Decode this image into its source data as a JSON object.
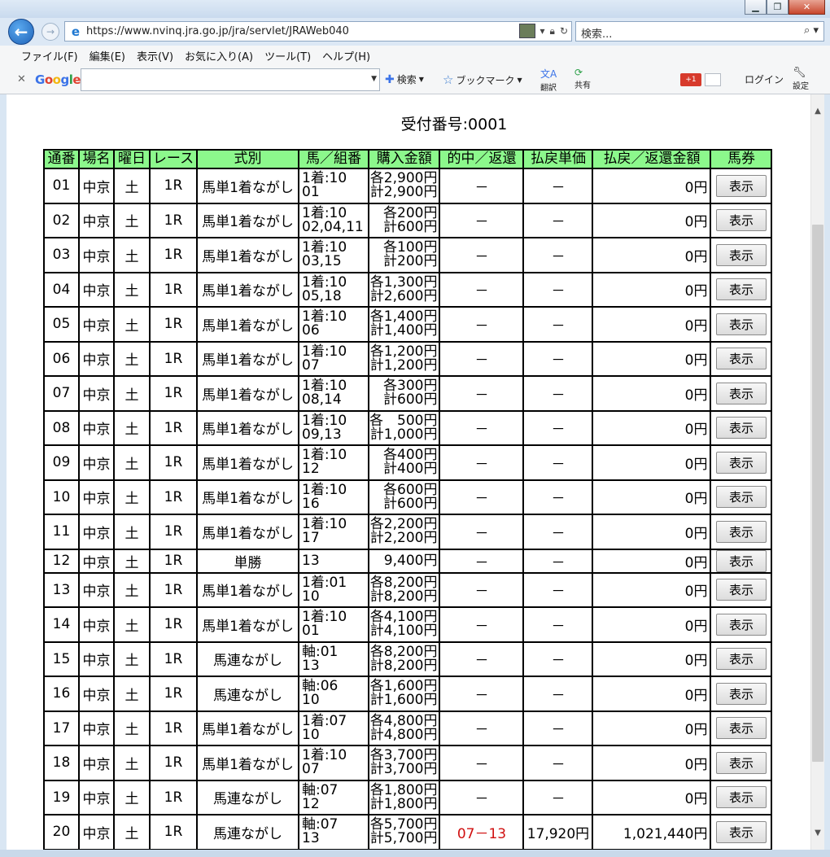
{
  "window": {
    "address_url": "https://www.nvinq.jra.go.jp/jra/servlet/JRAWeb040",
    "search_placeholder": "検索...",
    "menu": [
      "ファイル(F)",
      "編集(E)",
      "表示(V)",
      "お気に入り(A)",
      "ツール(T)",
      "ヘルプ(H)"
    ],
    "toolbar": {
      "google_logo": "Google",
      "search_label": "検索",
      "bookmark_label": "ブックマーク",
      "translate_label": "翻訳",
      "share_label": "共有",
      "gplus_label": "+1",
      "login_label": "ログイン",
      "settings_label": "設定"
    }
  },
  "page": {
    "receipt_label": "受付番号:0001",
    "headers": [
      "通番",
      "場名",
      "曜日",
      "レース",
      "式別",
      "馬／組番",
      "購入金額",
      "的中／返還",
      "払戻単価",
      "払戻／返還金額",
      "馬券"
    ],
    "button_label": "表示",
    "rows": [
      {
        "no": "01",
        "place": "中京",
        "day": "土",
        "race": "1R",
        "type": "馬単1着ながし",
        "combo1": "1着:10",
        "combo2": "01",
        "amt1": "各2,900円",
        "amt2": "計2,900円",
        "hit": "－",
        "unit": "－",
        "payout": "0円"
      },
      {
        "no": "02",
        "place": "中京",
        "day": "土",
        "race": "1R",
        "type": "馬単1着ながし",
        "combo1": "1着:10",
        "combo2": "02,04,11",
        "amt1": "各200円",
        "amt2": "計600円",
        "hit": "－",
        "unit": "－",
        "payout": "0円"
      },
      {
        "no": "03",
        "place": "中京",
        "day": "土",
        "race": "1R",
        "type": "馬単1着ながし",
        "combo1": "1着:10",
        "combo2": "03,15",
        "amt1": "各100円",
        "amt2": "計200円",
        "hit": "－",
        "unit": "－",
        "payout": "0円"
      },
      {
        "no": "04",
        "place": "中京",
        "day": "土",
        "race": "1R",
        "type": "馬単1着ながし",
        "combo1": "1着:10",
        "combo2": "05,18",
        "amt1": "各1,300円",
        "amt2": "計2,600円",
        "hit": "－",
        "unit": "－",
        "payout": "0円"
      },
      {
        "no": "05",
        "place": "中京",
        "day": "土",
        "race": "1R",
        "type": "馬単1着ながし",
        "combo1": "1着:10",
        "combo2": "06",
        "amt1": "各1,400円",
        "amt2": "計1,400円",
        "hit": "－",
        "unit": "－",
        "payout": "0円"
      },
      {
        "no": "06",
        "place": "中京",
        "day": "土",
        "race": "1R",
        "type": "馬単1着ながし",
        "combo1": "1着:10",
        "combo2": "07",
        "amt1": "各1,200円",
        "amt2": "計1,200円",
        "hit": "－",
        "unit": "－",
        "payout": "0円"
      },
      {
        "no": "07",
        "place": "中京",
        "day": "土",
        "race": "1R",
        "type": "馬単1着ながし",
        "combo1": "1着:10",
        "combo2": "08,14",
        "amt1": "各300円",
        "amt2": "計600円",
        "hit": "－",
        "unit": "－",
        "payout": "0円"
      },
      {
        "no": "08",
        "place": "中京",
        "day": "土",
        "race": "1R",
        "type": "馬単1着ながし",
        "combo1": "1着:10",
        "combo2": "09,13",
        "amt1": "各　500円",
        "amt2": "計1,000円",
        "hit": "－",
        "unit": "－",
        "payout": "0円"
      },
      {
        "no": "09",
        "place": "中京",
        "day": "土",
        "race": "1R",
        "type": "馬単1着ながし",
        "combo1": "1着:10",
        "combo2": "12",
        "amt1": "各400円",
        "amt2": "計400円",
        "hit": "－",
        "unit": "－",
        "payout": "0円"
      },
      {
        "no": "10",
        "place": "中京",
        "day": "土",
        "race": "1R",
        "type": "馬単1着ながし",
        "combo1": "1着:10",
        "combo2": "16",
        "amt1": "各600円",
        "amt2": "計600円",
        "hit": "－",
        "unit": "－",
        "payout": "0円"
      },
      {
        "no": "11",
        "place": "中京",
        "day": "土",
        "race": "1R",
        "type": "馬単1着ながし",
        "combo1": "1着:10",
        "combo2": "17",
        "amt1": "各2,200円",
        "amt2": "計2,200円",
        "hit": "－",
        "unit": "－",
        "payout": "0円"
      },
      {
        "no": "12",
        "place": "中京",
        "day": "土",
        "race": "1R",
        "type": "単勝",
        "combo1": "13",
        "combo2": "",
        "amt1": "9,400円",
        "amt2": "",
        "hit": "－",
        "unit": "－",
        "payout": "0円"
      },
      {
        "no": "13",
        "place": "中京",
        "day": "土",
        "race": "1R",
        "type": "馬単1着ながし",
        "combo1": "1着:01",
        "combo2": "10",
        "amt1": "各8,200円",
        "amt2": "計8,200円",
        "hit": "－",
        "unit": "－",
        "payout": "0円"
      },
      {
        "no": "14",
        "place": "中京",
        "day": "土",
        "race": "1R",
        "type": "馬単1着ながし",
        "combo1": "1着:10",
        "combo2": "01",
        "amt1": "各4,100円",
        "amt2": "計4,100円",
        "hit": "－",
        "unit": "－",
        "payout": "0円"
      },
      {
        "no": "15",
        "place": "中京",
        "day": "土",
        "race": "1R",
        "type": "馬連ながし",
        "combo1": "軸:01",
        "combo2": "13",
        "amt1": "各8,200円",
        "amt2": "計8,200円",
        "hit": "－",
        "unit": "－",
        "payout": "0円"
      },
      {
        "no": "16",
        "place": "中京",
        "day": "土",
        "race": "1R",
        "type": "馬連ながし",
        "combo1": "軸:06",
        "combo2": "10",
        "amt1": "各1,600円",
        "amt2": "計1,600円",
        "hit": "－",
        "unit": "－",
        "payout": "0円"
      },
      {
        "no": "17",
        "place": "中京",
        "day": "土",
        "race": "1R",
        "type": "馬単1着ながし",
        "combo1": "1着:07",
        "combo2": "10",
        "amt1": "各4,800円",
        "amt2": "計4,800円",
        "hit": "－",
        "unit": "－",
        "payout": "0円"
      },
      {
        "no": "18",
        "place": "中京",
        "day": "土",
        "race": "1R",
        "type": "馬単1着ながし",
        "combo1": "1着:10",
        "combo2": "07",
        "amt1": "各3,700円",
        "amt2": "計3,700円",
        "hit": "－",
        "unit": "－",
        "payout": "0円"
      },
      {
        "no": "19",
        "place": "中京",
        "day": "土",
        "race": "1R",
        "type": "馬連ながし",
        "combo1": "軸:07",
        "combo2": "12",
        "amt1": "各1,800円",
        "amt2": "計1,800円",
        "hit": "－",
        "unit": "－",
        "payout": "0円"
      },
      {
        "no": "20",
        "place": "中京",
        "day": "土",
        "race": "1R",
        "type": "馬連ながし",
        "combo1": "軸:07",
        "combo2": "13",
        "amt1": "各5,700円",
        "amt2": "計5,700円",
        "hit": "07－13",
        "unit": "17,920円",
        "payout": "1,021,440円",
        "is_hit": true
      }
    ]
  },
  "colors": {
    "header_bg": "#8cf88c",
    "hit_text": "#d01010"
  }
}
